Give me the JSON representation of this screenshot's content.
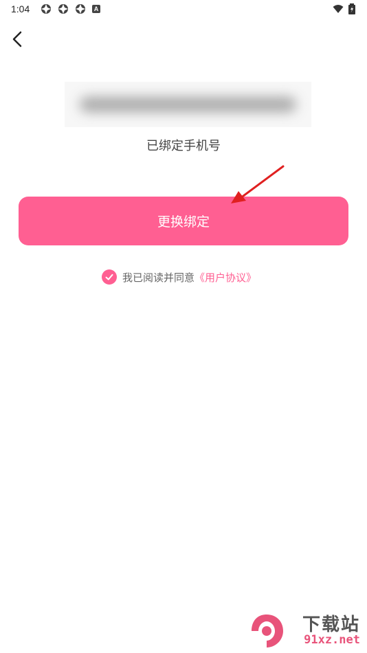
{
  "status_bar": {
    "time": "1:04",
    "badge": "A"
  },
  "page": {
    "phone_label": "已绑定手机号",
    "change_button_label": "更换绑定",
    "agreement_text": "我已阅读并同意",
    "agreement_link": "《用户协议》"
  },
  "watermark": {
    "top": "下载站",
    "bottom": "91xz.net"
  },
  "icons": {
    "back": "chevron-left-icon",
    "check": "check-icon",
    "wifi": "wifi-icon",
    "battery": "battery-icon"
  },
  "colors": {
    "accent": "#ff5f92",
    "annotation_arrow": "#e02020"
  }
}
